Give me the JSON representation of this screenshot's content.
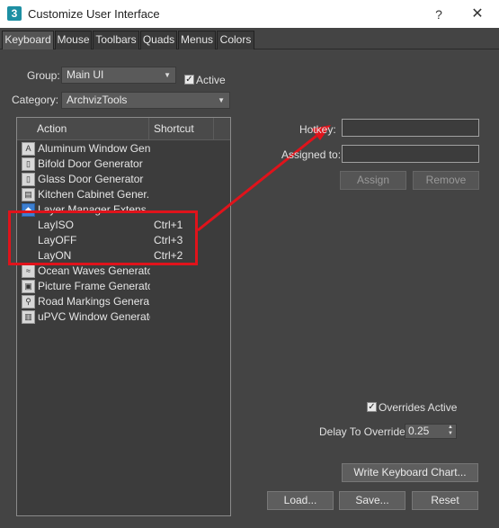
{
  "window": {
    "app_icon_text": "3",
    "title": "Customize User Interface",
    "help_glyph": "?",
    "close_glyph": "✕"
  },
  "tabs": [
    {
      "label": "Keyboard",
      "active": true
    },
    {
      "label": "Mouse"
    },
    {
      "label": "Toolbars"
    },
    {
      "label": "Quads"
    },
    {
      "label": "Menus"
    },
    {
      "label": "Colors"
    }
  ],
  "group": {
    "label": "Group:",
    "value": "Main UI",
    "active_label": "Active",
    "active_checked": true
  },
  "category": {
    "label": "Category:",
    "value": "ArchvizTools"
  },
  "actions_list": {
    "columns": {
      "action": "Action",
      "shortcut": "Shortcut"
    },
    "rows": [
      {
        "icon": "aluminum-window-icon",
        "icon_glyph": "A",
        "action": "Aluminum Window Gen...",
        "shortcut": ""
      },
      {
        "icon": "bifold-door-icon",
        "icon_glyph": "▯",
        "action": "Bifold Door Generator",
        "shortcut": ""
      },
      {
        "icon": "glass-door-icon",
        "icon_glyph": "▯",
        "action": "Glass Door Generator",
        "shortcut": ""
      },
      {
        "icon": "kitchen-cabinet-icon",
        "icon_glyph": "▤",
        "action": "Kitchen Cabinet Gener...",
        "shortcut": ""
      },
      {
        "icon": "layer-manager-icon",
        "icon_glyph": "◆",
        "action": "Layer Manager Extens...",
        "shortcut": ""
      },
      {
        "icon": "",
        "icon_glyph": "",
        "action": "LayISO",
        "shortcut": "Ctrl+1"
      },
      {
        "icon": "",
        "icon_glyph": "",
        "action": "LayOFF",
        "shortcut": "Ctrl+3"
      },
      {
        "icon": "",
        "icon_glyph": "",
        "action": "LayON",
        "shortcut": "Ctrl+2"
      },
      {
        "icon": "ocean-waves-icon",
        "icon_glyph": "≈",
        "action": "Ocean Waves Generator",
        "shortcut": ""
      },
      {
        "icon": "picture-frame-icon",
        "icon_glyph": "▣",
        "action": "Picture Frame Generator",
        "shortcut": ""
      },
      {
        "icon": "road-markings-icon",
        "icon_glyph": "⚲",
        "action": "Road Markings Genera...",
        "shortcut": ""
      },
      {
        "icon": "upvc-window-icon",
        "icon_glyph": "▥",
        "action": "uPVC Window Generator",
        "shortcut": ""
      }
    ]
  },
  "hotkey": {
    "label": "Hotkey:",
    "value": ""
  },
  "assigned_to": {
    "label": "Assigned to:",
    "value": ""
  },
  "buttons": {
    "assign": "Assign",
    "remove": "Remove",
    "write_chart": "Write Keyboard Chart...",
    "load": "Load...",
    "save": "Save...",
    "reset": "Reset"
  },
  "overrides": {
    "label": "Overrides Active",
    "checked": true
  },
  "delay": {
    "label": "Delay To Override:",
    "value": "0.25"
  },
  "colors": {
    "highlight": "#e0131b",
    "background": "#444444"
  }
}
